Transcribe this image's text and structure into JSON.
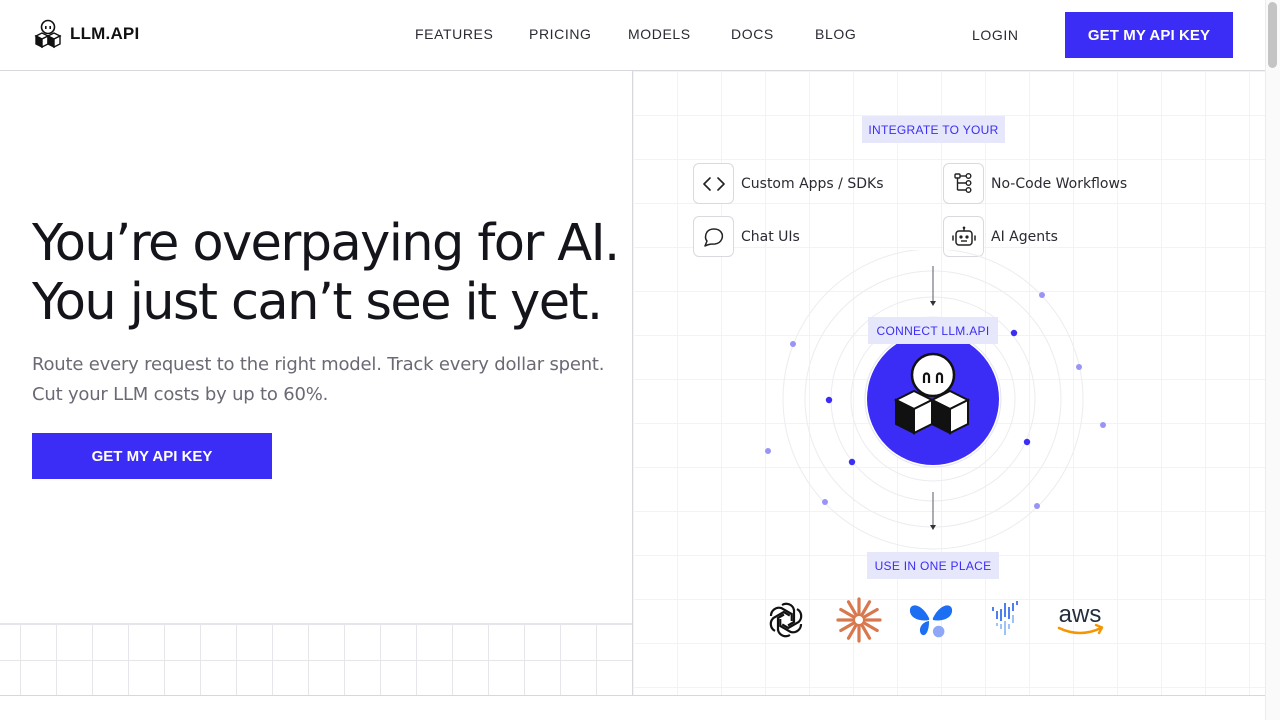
{
  "brand": {
    "name": "LLM.API",
    "accent": "#3b2df5"
  },
  "nav": {
    "links": [
      "FEATURES",
      "PRICING",
      "MODELS",
      "DOCS",
      "BLOG"
    ],
    "login": "LOGIN",
    "cta": "GET MY API KEY"
  },
  "hero": {
    "title_line1": "You’re overpaying for AI.",
    "title_line2": "You just can’t see it yet.",
    "sub_line1": "Route every request to the right model. Track every dollar spent.",
    "sub_line2": "Cut your LLM costs by up to 60%.",
    "cta": "GET MY API KEY"
  },
  "diagram": {
    "integrate_label": "INTEGRATE TO YOUR",
    "integrations": [
      {
        "label": "Custom Apps / SDKs",
        "icon": "code-brackets-icon"
      },
      {
        "label": "No-Code Workflows",
        "icon": "workflow-tree-icon"
      },
      {
        "label": "Chat UIs",
        "icon": "chat-bubble-icon"
      },
      {
        "label": "AI Agents",
        "icon": "robot-icon"
      }
    ],
    "connect_label": "CONNECT LLM.API",
    "use_label": "USE IN ONE PLACE",
    "providers": [
      {
        "icon": "openai-logo-icon",
        "color": "#111111"
      },
      {
        "icon": "anthropic-burst-logo-icon",
        "color": "#d9774d"
      },
      {
        "icon": "butterfly-logo-icon",
        "color": "#1c6ef2"
      },
      {
        "icon": "dotted-v-logo-icon",
        "color": "#4d7ff0"
      },
      {
        "icon": "aws-logo-icon",
        "text": "aws",
        "color": "#232f3e",
        "smile": "#f79500"
      }
    ]
  }
}
